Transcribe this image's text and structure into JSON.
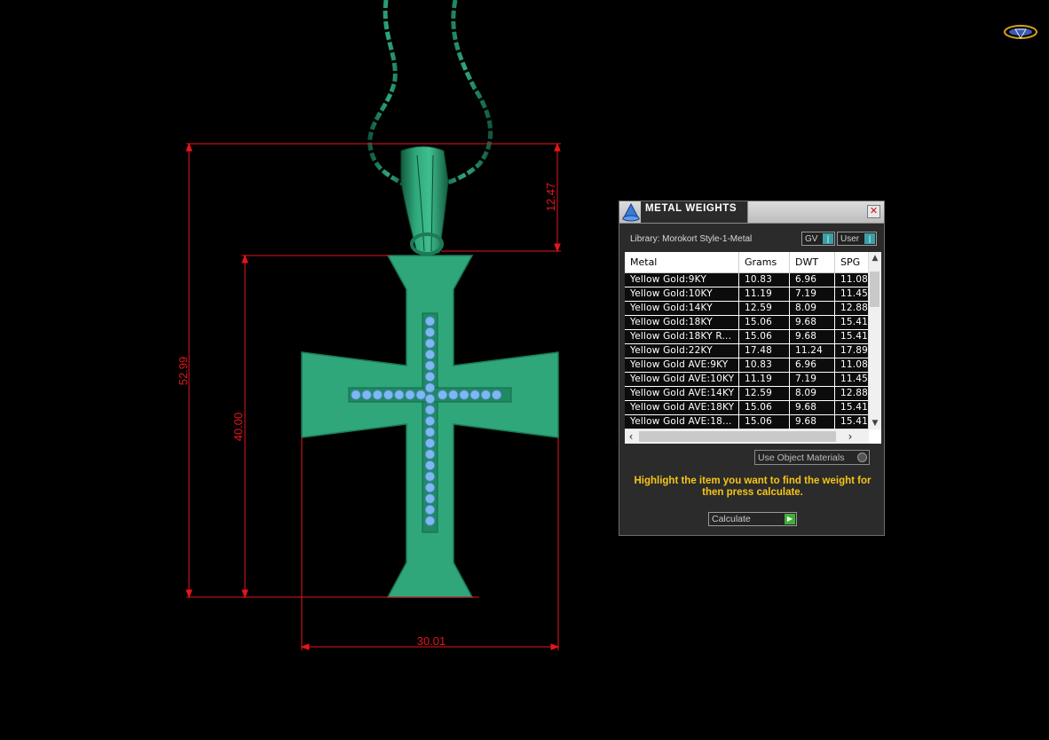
{
  "dimensions": {
    "total_height": "52.99",
    "body_height": "40.00",
    "bail_height": "12.47",
    "width": "30.01"
  },
  "panel": {
    "title": "METAL WEIGHTS",
    "close_icon": "close-icon",
    "library_label": "Library: Morokort Style-1-Metal",
    "toggle_gv": "GV",
    "toggle_user": "User",
    "columns": [
      "Metal",
      "Grams",
      "DWT",
      "SPG"
    ],
    "rows": [
      [
        "Yellow Gold:9KY",
        "10.83",
        "6.96",
        "11.08"
      ],
      [
        "Yellow Gold:10KY",
        "11.19",
        "7.19",
        "11.45"
      ],
      [
        "Yellow Gold:14KY",
        "12.59",
        "8.09",
        "12.88"
      ],
      [
        "Yellow Gold:18KY",
        "15.06",
        "9.68",
        "15.41"
      ],
      [
        "Yellow Gold:18KY R...",
        "15.06",
        "9.68",
        "15.41"
      ],
      [
        "Yellow Gold:22KY",
        "17.48",
        "11.24",
        "17.89"
      ],
      [
        "Yellow Gold AVE:9KY",
        "10.83",
        "6.96",
        "11.08"
      ],
      [
        "Yellow Gold AVE:10KY",
        "11.19",
        "7.19",
        "11.45"
      ],
      [
        "Yellow Gold AVE:14KY",
        "12.59",
        "8.09",
        "12.88"
      ],
      [
        "Yellow Gold AVE:18KY",
        "15.06",
        "9.68",
        "15.41"
      ],
      [
        "Yellow Gold AVE:18...",
        "15.06",
        "9.68",
        "15.41"
      ]
    ],
    "use_object_materials": "Use Object Materials",
    "hint": "Highlight the item you want to find the weight for then press calculate.",
    "calculate_label": "Calculate"
  },
  "colors": {
    "metal": "#2fa77b",
    "dimension_lines": "#e8141b",
    "hint_text": "#f5c518"
  }
}
